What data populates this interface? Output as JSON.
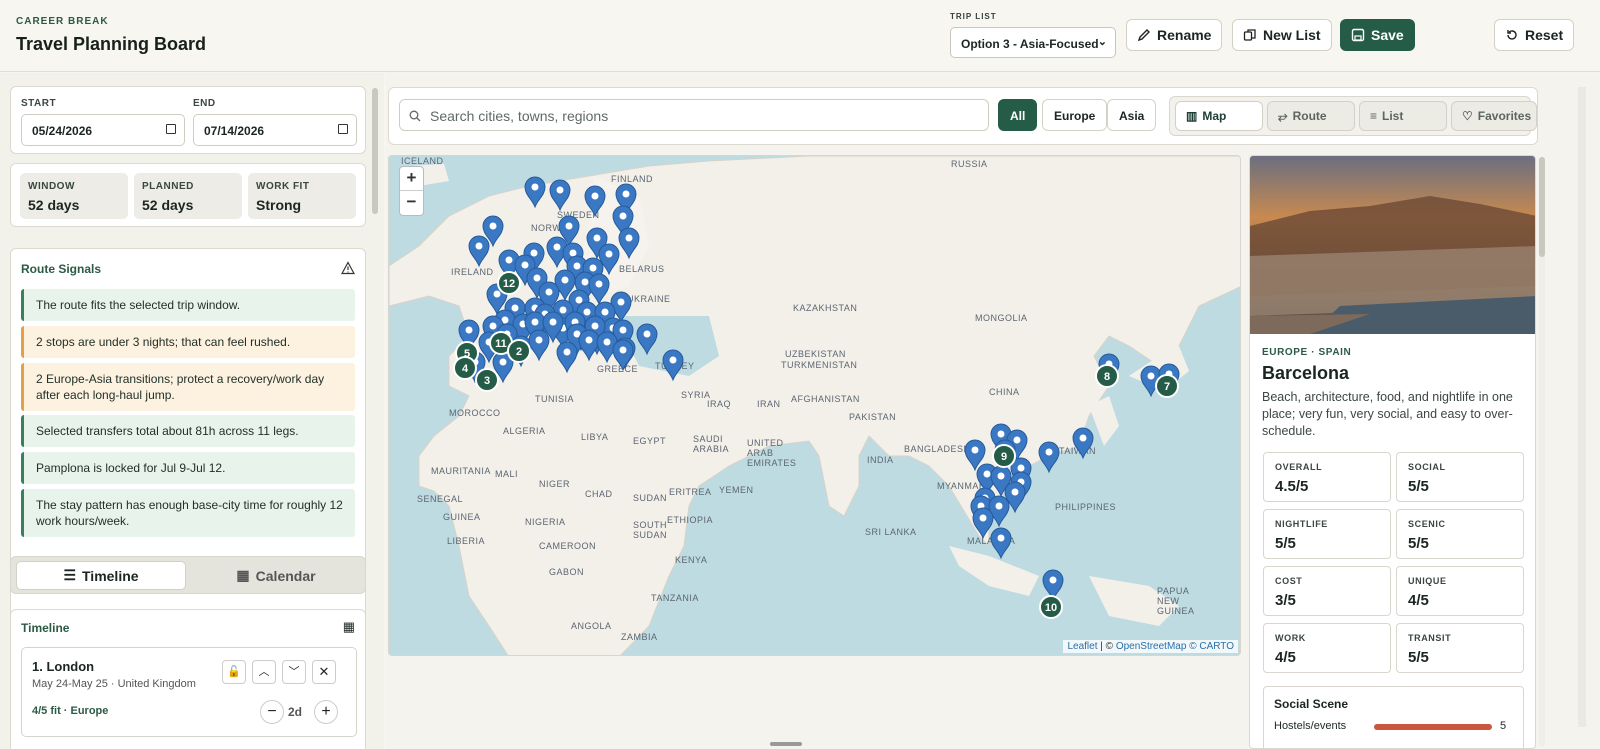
{
  "header": {
    "eyebrow": "CAREER BREAK",
    "title": "Travel Planning Board",
    "trip_list_label": "TRIP LIST",
    "trip_list_value": "Option 3 - Asia-Focused",
    "rename": "Rename",
    "new_list": "New List",
    "save": "Save",
    "reset": "Reset"
  },
  "dates": {
    "start_label": "START",
    "start": "05/24/2026",
    "end_label": "END",
    "end": "07/14/2026"
  },
  "stats": [
    {
      "label": "WINDOW",
      "value": "52 days"
    },
    {
      "label": "PLANNED",
      "value": "52 days"
    },
    {
      "label": "WORK FIT",
      "value": "Strong"
    }
  ],
  "signals": {
    "title": "Route Signals",
    "items": [
      {
        "text": "The route fits the selected trip window.",
        "tone": "green"
      },
      {
        "text": "2 stops are under 3 nights; that can feel rushed.",
        "tone": "orange"
      },
      {
        "text": "2 Europe-Asia transitions; protect a recovery/work day after each long-haul jump.",
        "tone": "orange"
      },
      {
        "text": "Selected transfers total about 81h across 11 legs.",
        "tone": "green"
      },
      {
        "text": "Pamplona is locked for Jul 9-Jul 12.",
        "tone": "green"
      },
      {
        "text": "The stay pattern has enough base-city time for roughly 12 work hours/week.",
        "tone": "green"
      }
    ]
  },
  "tabs": {
    "timeline": "Timeline",
    "calendar": "Calendar"
  },
  "timeline": {
    "title": "Timeline",
    "first": {
      "name": "1. London",
      "dates": "May 24-May 25 · United Kingdom",
      "fit": "4/5 fit · Europe",
      "duration": "2d"
    }
  },
  "search": {
    "placeholder": "Search cities, towns, regions"
  },
  "filters": [
    "All",
    "Europe",
    "Asia"
  ],
  "views": [
    "Map",
    "Route",
    "List",
    "Favorites"
  ],
  "map": {
    "labels": [
      "ICELAND",
      "RUSSIA",
      "FINLAND",
      "SWEDEN",
      "NORWAY",
      "BELARUS",
      "IRELAND",
      "UKRAINE",
      "KAZAKHSTAN",
      "MONGOLIA",
      "UZBEKISTAN",
      "TURKMENISTAN",
      "TURKEY",
      "GREECE",
      "CHINA",
      "TUNISIA",
      "SYRIA",
      "IRAQ",
      "IRAN",
      "AFGHANISTAN",
      "PAKISTAN",
      "MOROCCO",
      "ALGERIA",
      "LIBYA",
      "EGYPT",
      "SAUDI ARABIA",
      "UNITED ARAB EMIRATES",
      "INDIA",
      "BANGLADESH",
      "TAIWAN",
      "MAURITANIA",
      "MALI",
      "NIGER",
      "CHAD",
      "SUDAN",
      "ERITREA",
      "YEMEN",
      "MYANMAR",
      "SENEGAL",
      "GUINEA",
      "LIBERIA",
      "NIGERIA",
      "SOUTH SUDAN",
      "ETHIOPIA",
      "SRI LANKA",
      "PHILIPPINES",
      "CAMEROON",
      "GABON",
      "KENYA",
      "TANZANIA",
      "ANGOLA",
      "ZAMBIA",
      "MALAYSIA",
      "PAPUA NEW GUINEA"
    ],
    "clusters": [
      "12",
      "11",
      "5",
      "2",
      "4",
      "3",
      "9",
      "8",
      "7",
      "10"
    ],
    "zoom_in": "+",
    "zoom_out": "−",
    "attribution_leaflet": "Leaflet",
    "attribution_mid": "| ©",
    "attribution_osm": "OpenStreetMap",
    "attribution_carto": "© CARTO"
  },
  "detail": {
    "region": "EUROPE · SPAIN",
    "city": "Barcelona",
    "desc": "Beach, architecture, food, and nightlife in one place; very fun, very social, and easy to over-schedule.",
    "metrics": [
      {
        "k": "OVERALL",
        "v": "4.5/5"
      },
      {
        "k": "SOCIAL",
        "v": "5/5"
      },
      {
        "k": "NIGHTLIFE",
        "v": "5/5"
      },
      {
        "k": "SCENIC",
        "v": "5/5"
      },
      {
        "k": "COST",
        "v": "3/5"
      },
      {
        "k": "UNIQUE",
        "v": "4/5"
      },
      {
        "k": "WORK",
        "v": "4/5"
      },
      {
        "k": "TRANSIT",
        "v": "5/5"
      }
    ],
    "social_title": "Social Scene",
    "social_row": "Hostels/events",
    "social_score": "5",
    "social_level": 1.0
  },
  "colors": {
    "accent": "#245c47",
    "pin": "#3a78c4",
    "warn": "#e2a04a",
    "bar": "#c9573c"
  }
}
